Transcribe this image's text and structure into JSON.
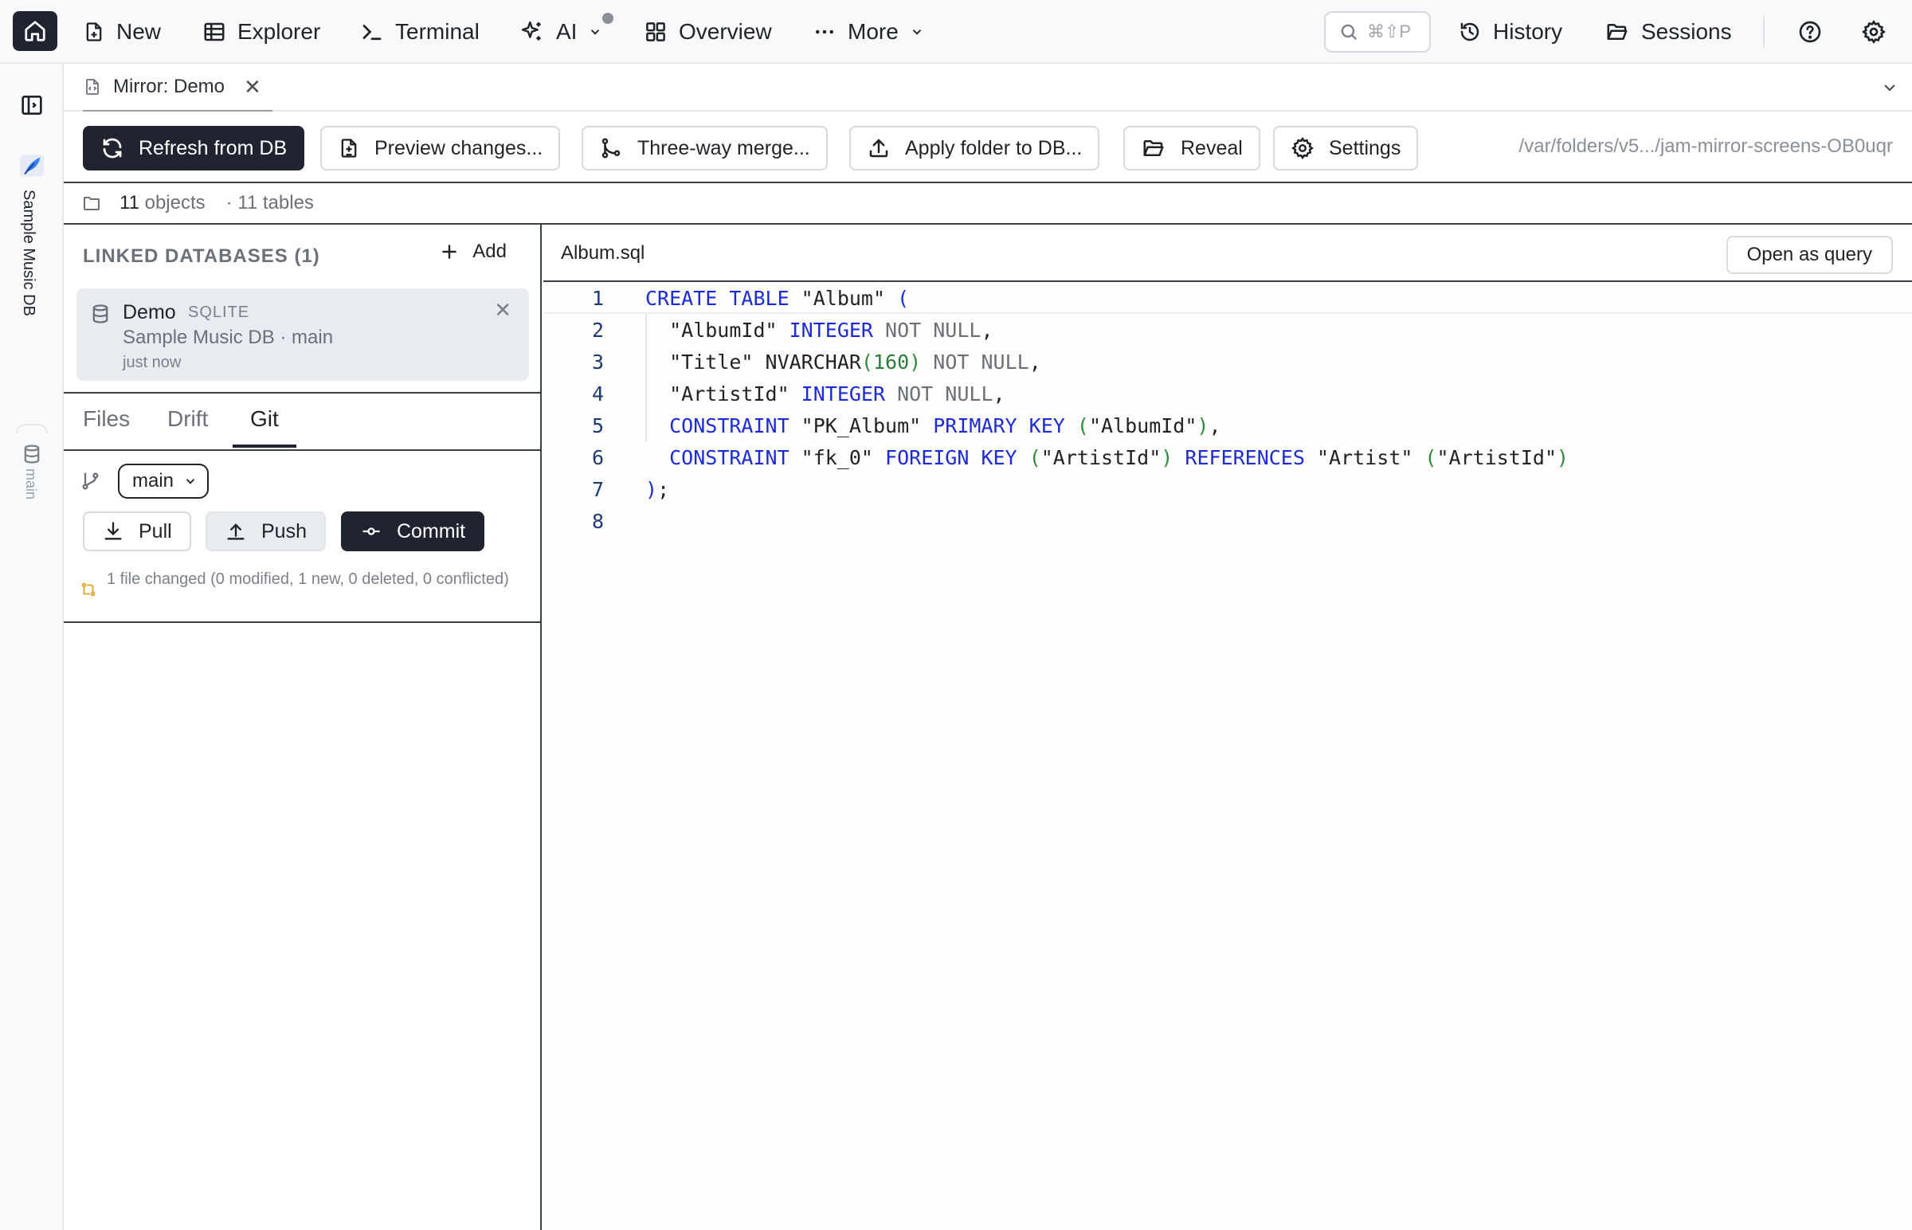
{
  "topbar": {
    "nav": [
      {
        "id": "new",
        "label": "New"
      },
      {
        "id": "explorer",
        "label": "Explorer"
      },
      {
        "id": "terminal",
        "label": "Terminal"
      },
      {
        "id": "ai",
        "label": "AI"
      },
      {
        "id": "overview",
        "label": "Overview"
      },
      {
        "id": "more",
        "label": "More"
      }
    ],
    "search_shortcut": "⌘⇧P",
    "history_label": "History",
    "sessions_label": "Sessions"
  },
  "rail": {
    "project_label": "Sample Music DB",
    "branch_label": "main"
  },
  "tab": {
    "title": "Mirror: Demo"
  },
  "toolbar": {
    "refresh_label": "Refresh from DB",
    "preview_label": "Preview changes...",
    "merge_label": "Three-way merge...",
    "apply_label": "Apply folder to DB...",
    "reveal_label": "Reveal",
    "settings_label": "Settings",
    "path": "/var/folders/v5.../jam-mirror-screens-OB0uqr"
  },
  "status": {
    "objects_count": "11",
    "objects_label": "objects",
    "tables_text": "· 11 tables"
  },
  "linked": {
    "title": "LINKED DATABASES (1)",
    "add_label": "Add",
    "db": {
      "name": "Demo",
      "type": "SQLITE",
      "subtitle": "Sample Music DB · main",
      "time": "just now"
    }
  },
  "panel_tabs": {
    "files": "Files",
    "drift": "Drift",
    "git": "Git"
  },
  "git": {
    "branch": "main",
    "pull_label": "Pull",
    "push_label": "Push",
    "commit_label": "Commit",
    "changes_text": "1 file changed (0 modified, 1 new, 0 deleted, 0 conflicted)"
  },
  "editor": {
    "file_name": "Album.sql",
    "open_query_label": "Open as query",
    "line_numbers": [
      "1",
      "2",
      "3",
      "4",
      "5",
      "6",
      "7",
      "8"
    ],
    "lines": [
      [
        {
          "t": "CREATE TABLE",
          "c": "kw"
        },
        {
          "t": " \"Album\" ",
          "c": ""
        },
        {
          "t": "(",
          "c": "par-b"
        }
      ],
      [
        {
          "t": "  \"AlbumId\" ",
          "c": ""
        },
        {
          "t": "INTEGER",
          "c": "kw"
        },
        {
          "t": " NOT NULL",
          "c": "nn"
        },
        {
          "t": ",",
          "c": ""
        }
      ],
      [
        {
          "t": "  \"Title\" NVARCHAR",
          "c": ""
        },
        {
          "t": "(",
          "c": "par"
        },
        {
          "t": "160",
          "c": "num"
        },
        {
          "t": ")",
          "c": "par"
        },
        {
          "t": " NOT NULL",
          "c": "nn"
        },
        {
          "t": ",",
          "c": ""
        }
      ],
      [
        {
          "t": "  \"ArtistId\" ",
          "c": ""
        },
        {
          "t": "INTEGER",
          "c": "kw"
        },
        {
          "t": " NOT NULL",
          "c": "nn"
        },
        {
          "t": ",",
          "c": ""
        }
      ],
      [
        {
          "t": "  ",
          "c": ""
        },
        {
          "t": "CONSTRAINT",
          "c": "kw"
        },
        {
          "t": " \"PK_Album\" ",
          "c": ""
        },
        {
          "t": "PRIMARY KEY",
          "c": "kw"
        },
        {
          "t": " ",
          "c": ""
        },
        {
          "t": "(",
          "c": "par"
        },
        {
          "t": "\"AlbumId\"",
          "c": ""
        },
        {
          "t": ")",
          "c": "par"
        },
        {
          "t": ",",
          "c": ""
        }
      ],
      [
        {
          "t": "  ",
          "c": ""
        },
        {
          "t": "CONSTRAINT",
          "c": "kw"
        },
        {
          "t": " \"fk_0\" ",
          "c": ""
        },
        {
          "t": "FOREIGN KEY",
          "c": "kw"
        },
        {
          "t": " ",
          "c": ""
        },
        {
          "t": "(",
          "c": "par"
        },
        {
          "t": "\"ArtistId\"",
          "c": ""
        },
        {
          "t": ")",
          "c": "par"
        },
        {
          "t": " ",
          "c": ""
        },
        {
          "t": "REFERENCES",
          "c": "kw"
        },
        {
          "t": " \"Artist\" ",
          "c": ""
        },
        {
          "t": "(",
          "c": "par"
        },
        {
          "t": "\"ArtistId\"",
          "c": ""
        },
        {
          "t": ")",
          "c": "par"
        }
      ],
      [
        {
          "t": ")",
          "c": "par-b"
        },
        {
          "t": ";",
          "c": ""
        }
      ],
      []
    ]
  },
  "colors": {
    "dark_button": "#1f2430",
    "keyword": "#1d2bd6",
    "number": "#2a7d3a",
    "brand_accent": "#3b82f6"
  }
}
